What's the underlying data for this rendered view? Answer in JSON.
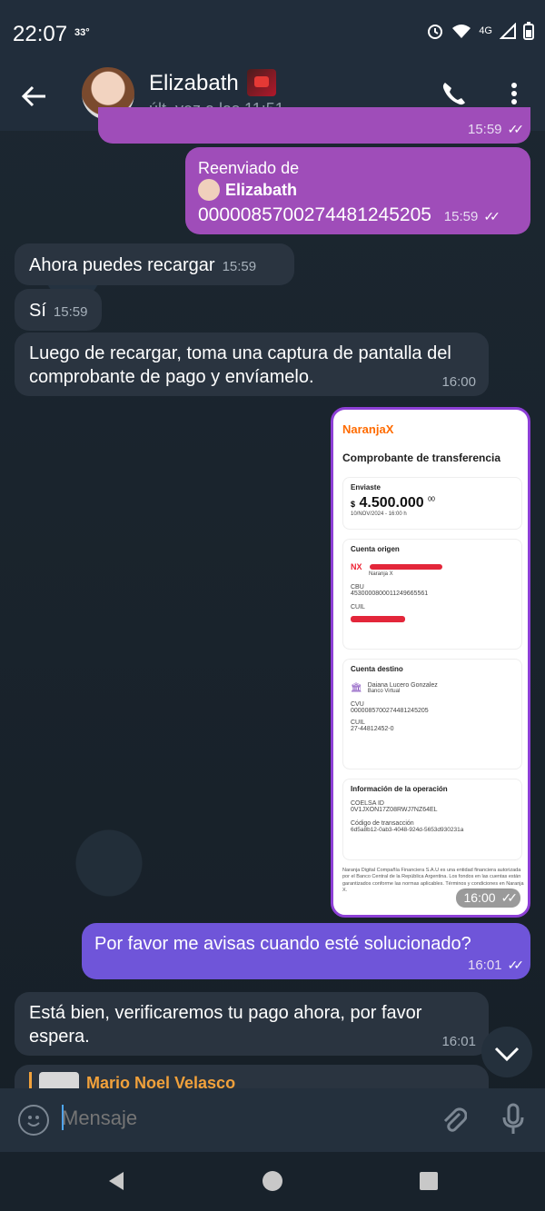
{
  "status": {
    "time": "22:07",
    "temperature": "33°",
    "network": "4G",
    "alarm_icon": "alarm-icon",
    "wifi_icon": "wifi-icon",
    "signal_icon": "signal-icon",
    "battery_icon": "battery-icon"
  },
  "header": {
    "contact_name": "Elizabath",
    "last_seen": "últ. vez a las 11:51",
    "badge_icon": "youtube-badge-icon"
  },
  "messages": [
    {
      "dir": "out",
      "time": "15:59",
      "text": ""
    },
    {
      "dir": "out",
      "forward_label": "Reenviado de",
      "forward_from": "Elizabath",
      "text": "0000085700274481245205",
      "time": "15:59"
    },
    {
      "dir": "in",
      "text": "Ahora puedes recargar",
      "time": "15:59"
    },
    {
      "dir": "in",
      "text": "Sí",
      "time": "15:59"
    },
    {
      "dir": "in",
      "text": "Luego de recargar, toma una captura de pantalla del comprobante de pago y envíamelo.",
      "time": "16:00"
    },
    {
      "dir": "out",
      "text": "Por favor me avisas cuando esté solucionado?",
      "time": "16:01"
    },
    {
      "dir": "in",
      "text": "Está bien, verificaremos tu pago ahora, por favor espera.",
      "time": "16:01"
    },
    {
      "dir": "in",
      "text": "Mario Noel Velasco"
    }
  ],
  "receipt": {
    "brand": "NaranjaX",
    "title": "Comprobante de transferencia",
    "sent_label": "Enviaste",
    "currency": "$",
    "amount": "4.500.000",
    "amount_cents": "00",
    "date": "10/NOV/2024 - 16:00 h",
    "origin_label": "Cuenta origen",
    "origin_prefix": "NX",
    "origin_bank": "Naranja X",
    "cbu_label": "CBU",
    "cbu_value": "4530000800011249665561",
    "cuil_label": "CUIL",
    "dest_label": "Cuenta destino",
    "dest_name": "Daiana Lucero Gonzalez",
    "dest_bank": "Banco Virtual",
    "cvu_label": "CVU",
    "cvu_value": "0000085700274481245205",
    "dest_cuil_label": "CUIL",
    "dest_cuil": "27-44812452-0",
    "op_label": "Información de la operación",
    "coelsa_label": "COELSA ID",
    "coelsa_value": "0V1JXON17Z08RWJ7NZ64EL",
    "tx_label": "Código de transacción",
    "tx_value": "6d5a8b12-0ab3-4048-924d-5653d930231a",
    "footer": "Naranja Digital Compañía Financiera S.A.U es una entidad financiera autorizada por el Banco Central de la República Argentina. Los fondos en las cuentas están garantizados conforme las normas aplicables. Términos y condiciones en Naranja X.",
    "time": "16:00"
  },
  "composer": {
    "placeholder": "Mensaje"
  }
}
